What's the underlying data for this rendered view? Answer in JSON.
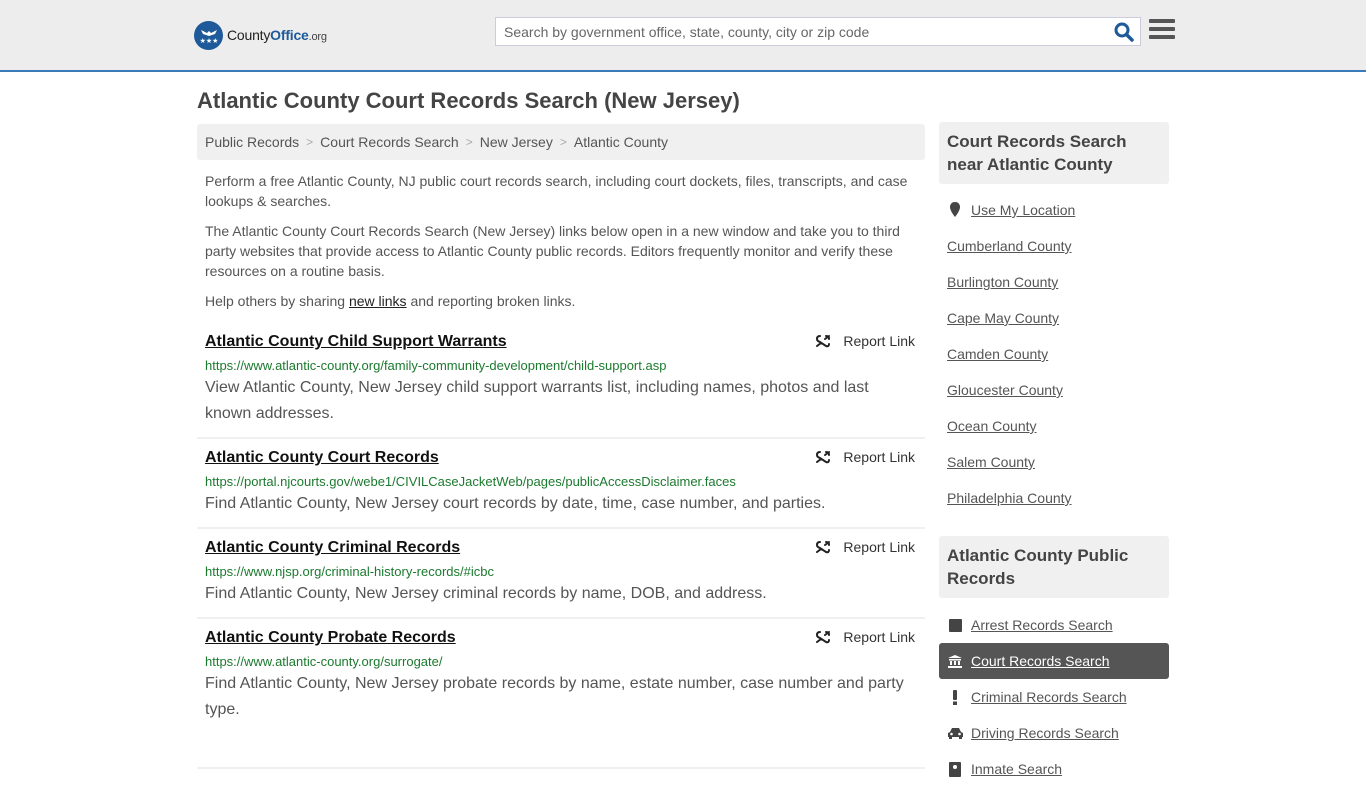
{
  "header": {
    "logo": {
      "part1": "County",
      "part2": "Office",
      "part3": ".org"
    },
    "search": {
      "placeholder": "Search by government office, state, county, city or zip code",
      "value": ""
    },
    "icons": {
      "search": "search-icon",
      "menu": "hamburger-menu-icon"
    }
  },
  "page": {
    "title": "Atlantic County Court Records Search (New Jersey)",
    "breadcrumb": [
      "Public Records",
      "Court Records Search",
      "New Jersey",
      "Atlantic County"
    ],
    "intro": {
      "p1": "Perform a free Atlantic County, NJ public court records search, including court dockets, files, transcripts, and case lookups & searches.",
      "p2": "The Atlantic County Court Records Search (New Jersey) links below open in a new window and take you to third party websites that provide access to Atlantic County public records. Editors frequently monitor and verify these resources on a routine basis.",
      "p3_before": "Help others by sharing ",
      "p3_link": "new links",
      "p3_after": " and reporting broken links."
    },
    "report_label": "Report Link",
    "results": [
      {
        "title": "Atlantic County Child Support Warrants",
        "url": "https://www.atlantic-county.org/family-community-development/child-support.asp",
        "desc": "View Atlantic County, New Jersey child support warrants list, including names, photos and last known addresses."
      },
      {
        "title": "Atlantic County Court Records",
        "url": "https://portal.njcourts.gov/webe1/CIVILCaseJacketWeb/pages/publicAccessDisclaimer.faces",
        "desc": "Find Atlantic County, New Jersey court records by date, time, case number, and parties."
      },
      {
        "title": "Atlantic County Criminal Records",
        "url": "https://www.njsp.org/criminal-history-records/#icbc",
        "desc": "Find Atlantic County, New Jersey criminal records by name, DOB, and address."
      },
      {
        "title": "Atlantic County Probate Records",
        "url": "https://www.atlantic-county.org/surrogate/",
        "desc": "Find Atlantic County, New Jersey probate records by name, estate number, case number and party type."
      }
    ]
  },
  "sidebar": {
    "nearby": {
      "title": "Court Records Search near Atlantic County",
      "use_location": "Use My Location",
      "counties": [
        "Cumberland County",
        "Burlington County",
        "Cape May County",
        "Camden County",
        "Gloucester County",
        "Ocean County",
        "Salem County",
        "Philadelphia County"
      ]
    },
    "public_records": {
      "title": "Atlantic County Public Records",
      "items": [
        {
          "label": "Arrest Records Search",
          "icon": "square-icon",
          "active": false
        },
        {
          "label": "Court Records Search",
          "icon": "courthouse-icon",
          "active": true
        },
        {
          "label": "Criminal Records Search",
          "icon": "exclamation-icon",
          "active": false
        },
        {
          "label": "Driving Records Search",
          "icon": "car-icon",
          "active": false
        },
        {
          "label": "Inmate Search",
          "icon": "inmate-icon",
          "active": false
        }
      ]
    }
  },
  "colors": {
    "accent": "#3a7bb8",
    "brand": "#1e5a9a",
    "url_green": "#1b7a2e",
    "active_bg": "#555555"
  }
}
